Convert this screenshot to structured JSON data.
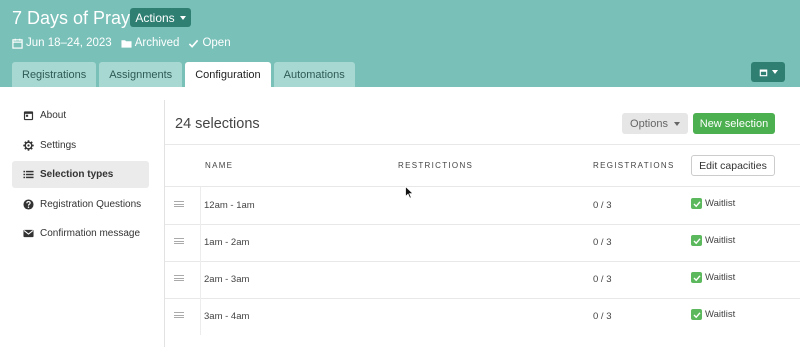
{
  "header": {
    "title": "7 Days of Prayer",
    "actions_label": "Actions",
    "date_range": "Jun 18–24, 2023",
    "archived_label": "Archived",
    "open_label": "Open",
    "tabs": [
      {
        "label": "Registrations"
      },
      {
        "label": "Assignments"
      },
      {
        "label": "Configuration"
      },
      {
        "label": "Automations"
      }
    ],
    "active_tab": "Configuration"
  },
  "sidebar": {
    "items": [
      {
        "label": "About",
        "icon": "calendar-icon"
      },
      {
        "label": "Settings",
        "icon": "gear-icon"
      },
      {
        "label": "Selection types",
        "icon": "list-icon"
      },
      {
        "label": "Registration Questions",
        "icon": "question-icon"
      },
      {
        "label": "Confirmation message",
        "icon": "envelope-icon"
      }
    ],
    "active_item": "Selection types"
  },
  "main": {
    "selection_count": "24 selections",
    "options_label": "Options",
    "new_selection_label": "New selection",
    "edit_capacities_label": "Edit capacities",
    "columns": [
      "NAME",
      "RESTRICTIONS",
      "REGISTRATIONS"
    ],
    "rows": [
      {
        "name": "12am - 1am",
        "registrations": "0 / 3",
        "waitlist": "Waitlist"
      },
      {
        "name": "1am - 2am",
        "registrations": "0 / 3",
        "waitlist": "Waitlist"
      },
      {
        "name": "2am - 3am",
        "registrations": "0 / 3",
        "waitlist": "Waitlist"
      },
      {
        "name": "3am - 4am",
        "registrations": "0 / 3",
        "waitlist": "Waitlist"
      }
    ]
  },
  "colors": {
    "header_bg": "#78c0b8",
    "accent_dark": "#2f7f73",
    "new_button": "#4caf50",
    "waitlist_check": "#5cb85c"
  }
}
